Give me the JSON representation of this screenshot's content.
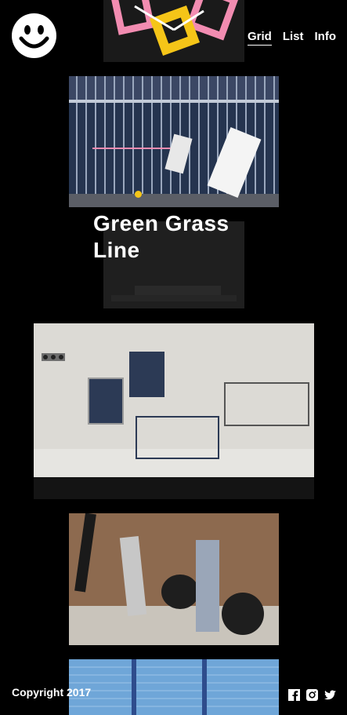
{
  "nav": {
    "items": [
      "Grid",
      "List",
      "Info"
    ],
    "active": "Grid"
  },
  "feature": {
    "title": "Green Grass Line"
  },
  "footer": {
    "copyright": "Copyright 2017"
  },
  "social": [
    "facebook-icon",
    "instagram-icon",
    "twitter-icon"
  ],
  "colors": {
    "accent": "#f5c518",
    "pink": "#f28cb1",
    "navy": "#2c3a55",
    "background": "#000000"
  }
}
